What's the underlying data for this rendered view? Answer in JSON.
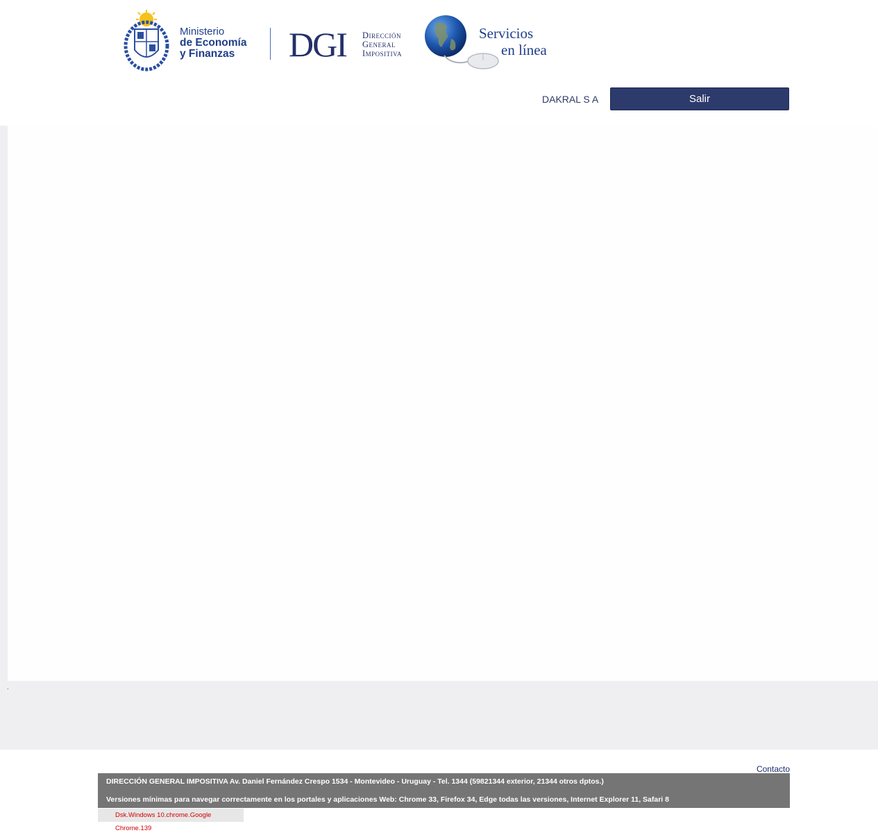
{
  "header": {
    "ministry": {
      "line1": "Ministerio",
      "line2": "de Economía",
      "line3": "y Finanzas"
    },
    "dgi": {
      "acronym": "DGI",
      "line1": "Dirección",
      "line2": "General",
      "line3": "Impositiva"
    },
    "servicios": {
      "line1": "Servicios",
      "line2": "en línea"
    },
    "user_name": "DAKRAL S A",
    "logout_label": "Salir"
  },
  "main": {
    "dot": "."
  },
  "footer": {
    "contact_label": "Contacto",
    "address": "DIRECCIÓN GENERAL IMPOSITIVA Av. Daniel Fernández Crespo 1534 - Montevideo - Uruguay - Tel. 1344 (59821344 exterior, 21344 otros dptos.)",
    "browsers": "Versiones mínimas para navegar correctamente en los portales y aplicaciones Web: Chrome 33, Firefox 34, Edge todas las versiones, Internet Explorer 11, Safari 8",
    "version_info": "Dsk.Windows 10.chrome.Google Chrome.139"
  },
  "colors": {
    "brand_navy": "#2d3a6c",
    "footer_gray": "#757575",
    "version_red": "#d10000"
  }
}
